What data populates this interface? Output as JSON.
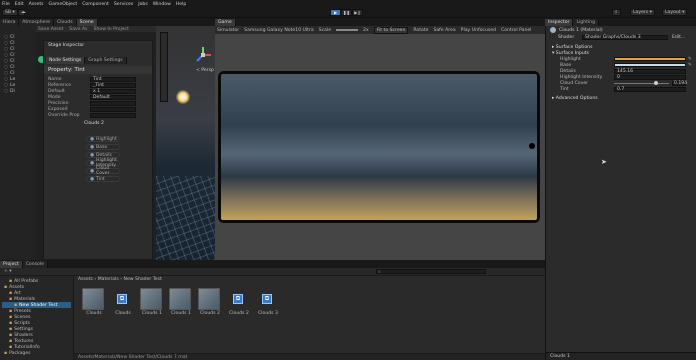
{
  "menubar": [
    "File",
    "Edit",
    "Assets",
    "GameObject",
    "Component",
    "Services",
    "Jobs",
    "Window",
    "Help"
  ],
  "toolbar": {
    "account": "SB",
    "right_buttons": [
      "Layers",
      "Layout"
    ]
  },
  "left_dock": {
    "tabs": [
      "Hiera",
      "Atmosphere",
      "Clouds",
      "Scene"
    ],
    "tree_letters": [
      "Cl",
      "Cl",
      "Cl",
      "Cl",
      "Cl",
      "Cl",
      "Cl",
      "Le",
      "Le",
      "Di"
    ],
    "gizmo_label": "< Persp"
  },
  "stage_inspector": {
    "title": "Stage Inspector",
    "tabs": [
      "Node Settings",
      "Graph Settings"
    ],
    "header": "Property: Tint",
    "rows": [
      {
        "label": "Name",
        "value": "Tint"
      },
      {
        "label": "Reference",
        "value": "_Tint"
      },
      {
        "label": "Default",
        "value": "x  1"
      },
      {
        "label": "Mode",
        "value": "Default"
      },
      {
        "label": "Precision",
        "value": ""
      },
      {
        "label": "Exposed",
        "value": ""
      },
      {
        "label": "Override Prop",
        "value": ""
      }
    ],
    "section": "Clouds 2",
    "chips": [
      "Highlight",
      "Base",
      "Details",
      "Highlight Intensity",
      "Cloud Cover",
      "Tint"
    ]
  },
  "game_view": {
    "tab": "Game",
    "display": "Simulator",
    "device": "Samsung Galaxy Note10 Ultra",
    "scale_label": "Scale",
    "scale_value": "2x",
    "fit_button": "Fit to Screen",
    "rotate": "Rotate",
    "safe_area": "Safe Area",
    "play_mode": "Play Unfocused",
    "control_panel": "Control Panel"
  },
  "project": {
    "tabs": [
      "Project",
      "Console"
    ],
    "search_placeholder": "",
    "breadcrumb": [
      "Assets",
      "Materials",
      "New Shader Test"
    ],
    "tree": [
      {
        "label": "All Prefabs",
        "indent": 1
      },
      {
        "label": "Assets",
        "indent": 0
      },
      {
        "label": "Art",
        "indent": 1
      },
      {
        "label": "Materials",
        "indent": 1
      },
      {
        "label": "New Shader Test",
        "indent": 2
      },
      {
        "label": "Presets",
        "indent": 1
      },
      {
        "label": "Scenes",
        "indent": 1
      },
      {
        "label": "Scripts",
        "indent": 1
      },
      {
        "label": "Settings",
        "indent": 1
      },
      {
        "label": "Shaders",
        "indent": 1
      },
      {
        "label": "Textures",
        "indent": 1
      },
      {
        "label": "TutorialInfo",
        "indent": 1
      },
      {
        "label": "Packages",
        "indent": 0
      }
    ],
    "assets": [
      {
        "label": "Clouds",
        "type": "material"
      },
      {
        "label": "Clouds",
        "type": "shader"
      },
      {
        "label": "Clouds 1",
        "type": "material"
      },
      {
        "label": "Clouds 1",
        "type": "material"
      },
      {
        "label": "Clouds 2",
        "type": "material"
      },
      {
        "label": "Clouds 2",
        "type": "shader"
      },
      {
        "label": "Clouds 3",
        "type": "shader"
      }
    ],
    "status_path": "Assets/Materials/New Shader Test/Clouds 7.mat"
  },
  "inspector": {
    "tabs": [
      "Inspector",
      "Lighting"
    ],
    "title": "Clouds 1 (Material)",
    "shader_label": "Shader",
    "shader_value": "Shader Graphs/Clouds 3",
    "edit_button": "Edit...",
    "section": "Surface Options",
    "inputs_header": "Surface Inputs",
    "props": [
      {
        "label": "Highlight",
        "value": "",
        "color": "#e8a33c"
      },
      {
        "label": "Base",
        "value": "",
        "color": "#c7dceb"
      },
      {
        "label": "Details",
        "value": "145.16"
      },
      {
        "label": "Highlight Intensity",
        "value": "0"
      },
      {
        "label": "Cloud Cover",
        "value": "0.194"
      },
      {
        "label": "Tint",
        "value": "0.7"
      }
    ],
    "advanced": "Advanced Options",
    "footer": "Clouds 1"
  }
}
